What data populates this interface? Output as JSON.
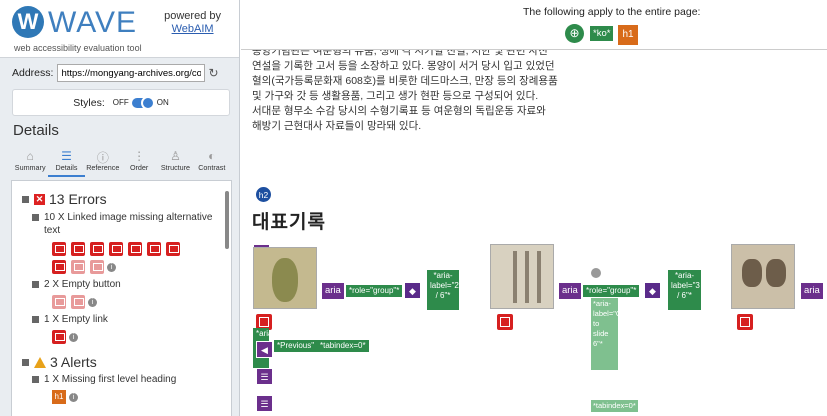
{
  "sidebar": {
    "logo_letter": "W",
    "logo_name": "WAVE",
    "tagline": "web accessibility evaluation tool",
    "powered_by": "powered by",
    "webaim": "WebAIM",
    "address_label": "Address:",
    "address_value": "https://mongyang-archives.org/collections/",
    "styles_label": "Styles:",
    "styles_off": "OFF",
    "styles_on": "ON",
    "details_heading": "Details",
    "tabs": [
      {
        "label": "Summary",
        "icon": "home-icon"
      },
      {
        "label": "Details",
        "icon": "list-icon"
      },
      {
        "label": "Reference",
        "icon": "info-icon"
      },
      {
        "label": "Order",
        "icon": "order-icon"
      },
      {
        "label": "Structure",
        "icon": "structure-icon"
      },
      {
        "label": "Contrast",
        "icon": "contrast-icon"
      }
    ],
    "errors_title": "13 Errors",
    "error_items": [
      "10 X Linked image missing alternative text",
      "2 X Empty button",
      "1 X Empty link"
    ],
    "alerts_title": "3 Alerts",
    "alert_items": [
      "1 X Missing first level heading"
    ]
  },
  "main": {
    "banner_text": "The following apply to the entire page:",
    "lang": "*ko*",
    "h1": "h1",
    "para": [
      "몽양기념관은 여운형의 유품, 생애 각 시기별 친필, 서한 및 관련 사진",
      "연설을 기록한 고서 등을 소장하고 있다. 몽양이 서거 당시 입고 있었던",
      "혈의(국가등록문화재 608호)를 비롯한 데드마스크, 만장 등의 장례용품",
      "및 가구와 갓 등 생활용품, 그리고 생가 현판 등으로 구성되어 있다.",
      "서대문 형무소 수감 당시의 수형기록표 등 여운형의 독립운동 자료와",
      "해방기 근현대사 자료들이 망라돼 있다."
    ],
    "h2": "h2",
    "heading": "대표기록",
    "aria": "aria",
    "role_group": "*role=\"group\"*",
    "label_2_6": "*aria-label=\"2 / 6\"*",
    "label_3_6": "*aria-label=\"3 / 6\"*",
    "aria_prev": "*aria-",
    "prev_text": "*Previous\"",
    "tabindex": "*tabindex=0*",
    "go_slide": "*aria-label=\"Go to slide 6\"*",
    "tabindex2": "*tabindex=0*"
  }
}
